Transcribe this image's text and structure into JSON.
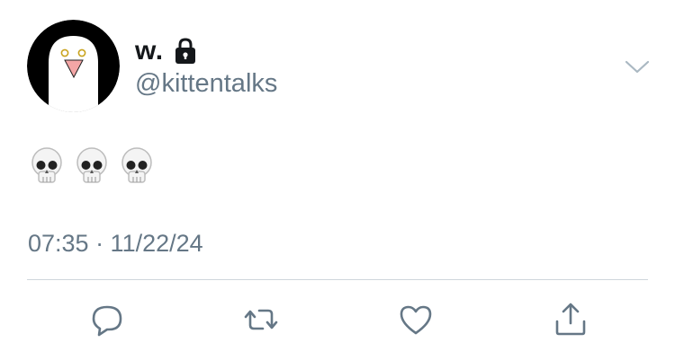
{
  "user": {
    "display_name": "w.",
    "handle": "@kittentalks",
    "protected_icon": "lock-icon",
    "avatar_icon": "penguin-avatar"
  },
  "tweet": {
    "emoji": [
      "💀",
      "💀",
      "💀"
    ],
    "timestamp": "07:35 · 11/22/24"
  },
  "actions": [
    {
      "name": "reply",
      "icon": "reply-icon"
    },
    {
      "name": "retweet",
      "icon": "retweet-icon"
    },
    {
      "name": "like",
      "icon": "heart-icon"
    },
    {
      "name": "share",
      "icon": "share-icon"
    }
  ],
  "colors": {
    "text_primary": "#14171a",
    "text_secondary": "#657786",
    "divider": "#cfd6dc",
    "icon": "#657786"
  }
}
